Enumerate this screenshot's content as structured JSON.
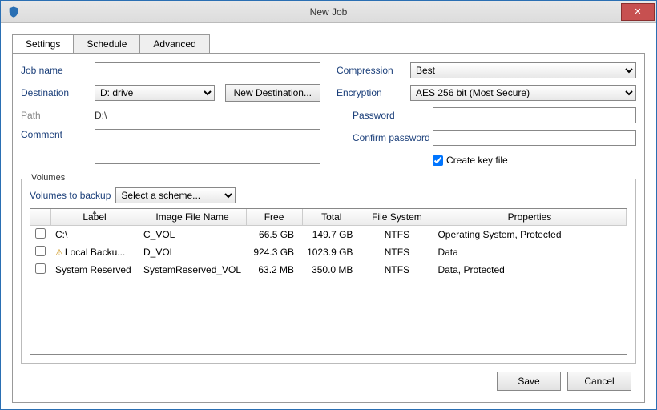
{
  "window": {
    "title": "New Job"
  },
  "tabs": {
    "settings": "Settings",
    "schedule": "Schedule",
    "advanced": "Advanced"
  },
  "labels": {
    "jobName": "Job name",
    "destination": "Destination",
    "path": "Path",
    "comment": "Comment",
    "compression": "Compression",
    "encryption": "Encryption",
    "password": "Password",
    "confirmPassword": "Confirm password",
    "createKeyFile": "Create key file",
    "volumesLegend": "Volumes",
    "volumesToBackup": "Volumes to backup"
  },
  "form": {
    "jobName": "",
    "destinationSelected": "D: drive",
    "pathValue": "D:\\",
    "comment": "",
    "newDestination": "New Destination...",
    "compressionSelected": "Best",
    "encryptionSelected": "AES 256 bit (Most Secure)",
    "password": "",
    "confirmPassword": "",
    "createKeyFileChecked": true,
    "schemeSelected": "Select a scheme..."
  },
  "gridHeaders": {
    "label": "Label",
    "imageFileName": "Image File Name",
    "free": "Free",
    "total": "Total",
    "fileSystem": "File System",
    "properties": "Properties"
  },
  "rows": [
    {
      "checked": false,
      "warn": false,
      "label": "C:\\",
      "img": "C_VOL",
      "free": "66.5 GB",
      "total": "149.7 GB",
      "fs": "NTFS",
      "props": "Operating System, Protected"
    },
    {
      "checked": false,
      "warn": true,
      "label": "Local Backu...",
      "img": "D_VOL",
      "free": "924.3 GB",
      "total": "1023.9 GB",
      "fs": "NTFS",
      "props": "Data"
    },
    {
      "checked": false,
      "warn": false,
      "label": "System Reserved",
      "img": "SystemReserved_VOL",
      "free": "63.2 MB",
      "total": "350.0 MB",
      "fs": "NTFS",
      "props": "Data, Protected"
    }
  ],
  "footer": {
    "save": "Save",
    "cancel": "Cancel"
  }
}
